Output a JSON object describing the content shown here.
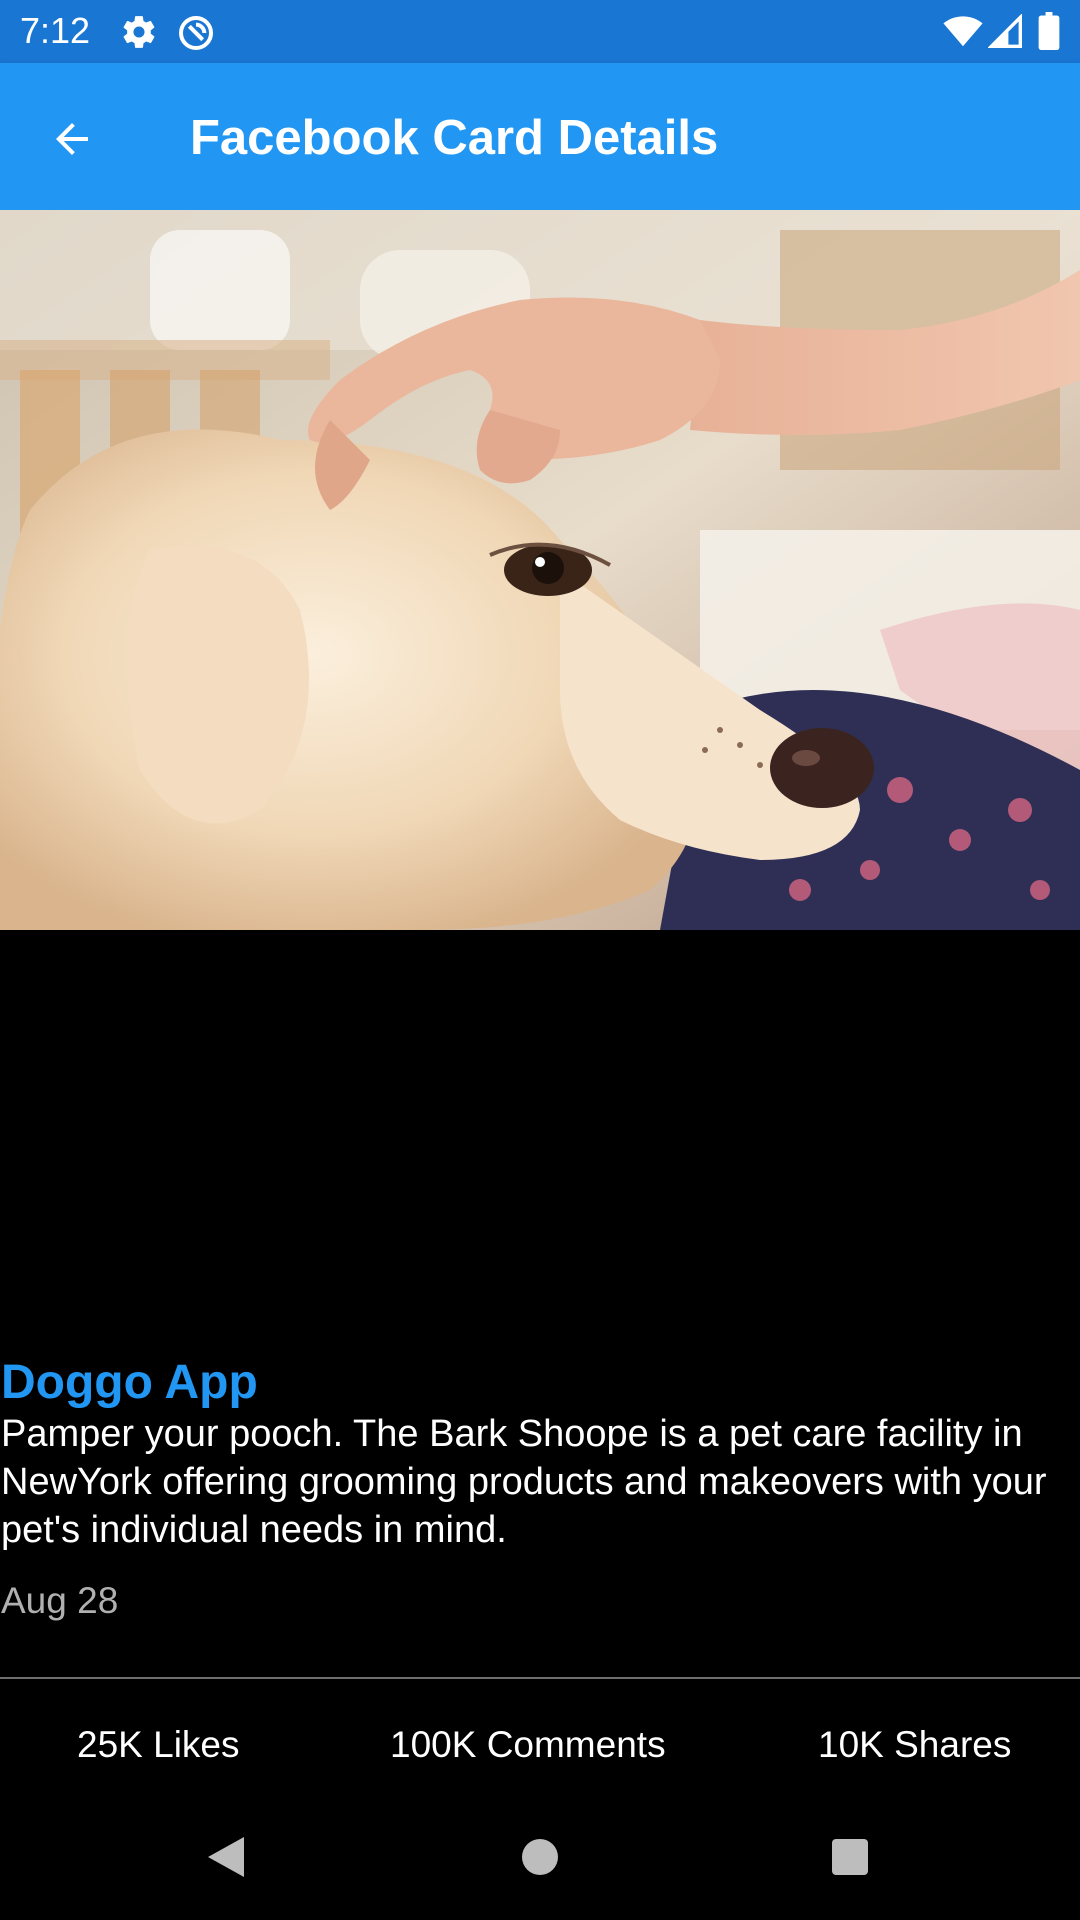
{
  "status_bar": {
    "time": "7:12",
    "left_icons": [
      "settings-gear-icon",
      "sync-icon"
    ],
    "right_icons": [
      "wifi-icon",
      "cell-signal-icon",
      "battery-icon"
    ],
    "background": "#1976D2"
  },
  "app_bar": {
    "title": "Facebook Card Details",
    "background": "#2196F3",
    "nav_icon": "arrow-back-icon"
  },
  "card": {
    "image_icon": "dog-photo",
    "title": "Doggo App",
    "description": "Pamper your pooch. The Bark Shoope is a pet care facility in NewYork offering grooming products and makeovers with your pet's individual needs in mind.",
    "date": "Aug 28",
    "title_color": "#2196F3"
  },
  "stats": {
    "likes": "25K Likes",
    "comments": "100K Comments",
    "shares": "10K Shares"
  },
  "nav_bar": {
    "icons": [
      "back-triangle-icon",
      "home-circle-icon",
      "recents-square-icon"
    ]
  }
}
